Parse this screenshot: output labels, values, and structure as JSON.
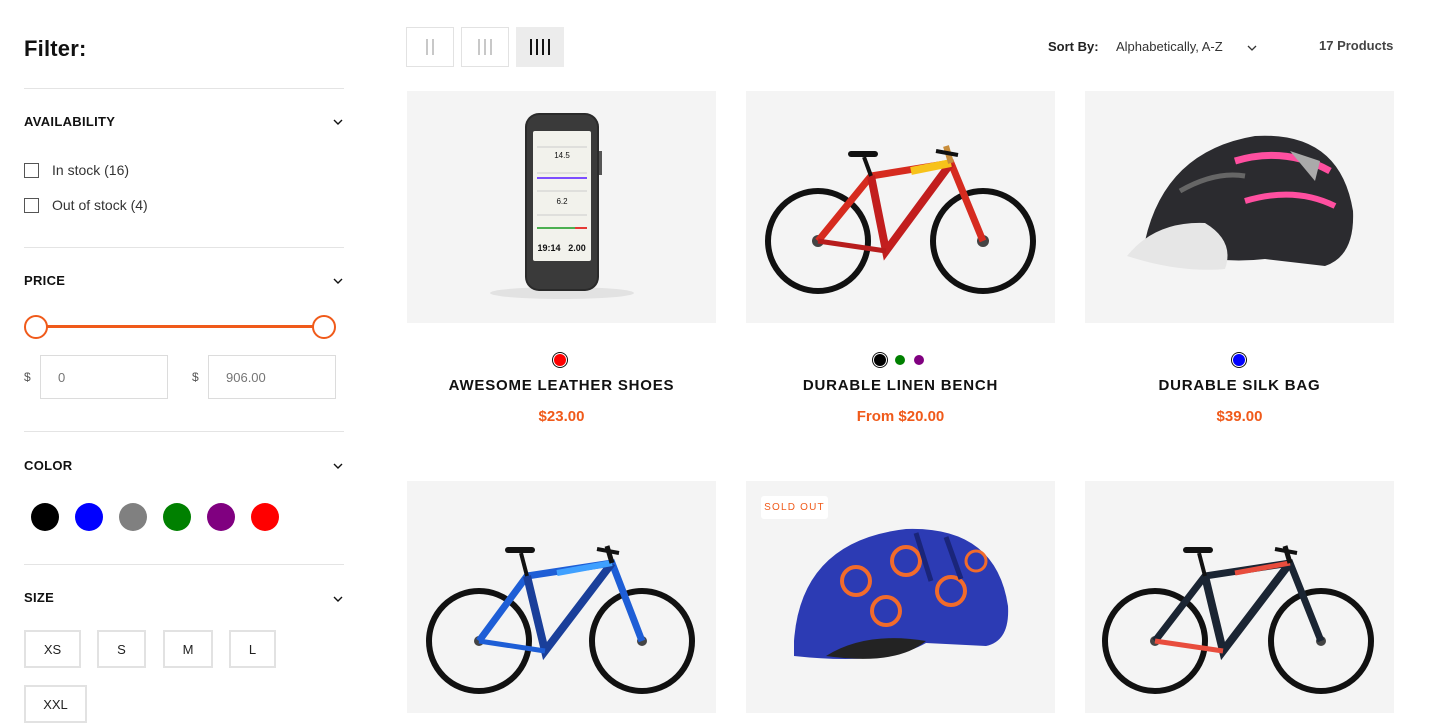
{
  "sidebar": {
    "title": "Filter:",
    "availability": {
      "title": "AVAILABILITY",
      "options": [
        {
          "label": "In stock (16)",
          "checked": false
        },
        {
          "label": "Out of stock (4)",
          "checked": false
        }
      ]
    },
    "price": {
      "title": "PRICE",
      "currency": "$",
      "min_value": "",
      "min_placeholder": "0",
      "max_value": "",
      "max_placeholder": "906.00"
    },
    "color": {
      "title": "COLOR",
      "swatches": [
        "#000000",
        "#0000ff",
        "#808080",
        "#008000",
        "#800080",
        "#ff0000"
      ]
    },
    "size": {
      "title": "SIZE",
      "options": [
        "XS",
        "S",
        "M",
        "L",
        "XXL"
      ]
    }
  },
  "toolbar": {
    "view_modes": [
      "2 columns",
      "3 columns",
      "4 columns"
    ],
    "active_view": "4 columns",
    "sort_label": "Sort By:",
    "sort_value": "Alphabetically, A-Z",
    "product_count": "17 Products"
  },
  "products": [
    {
      "name": "AWESOME LEATHER SHOES",
      "price": "$23.00",
      "colors": [
        "#ff0000"
      ],
      "image": "gps-computer"
    },
    {
      "name": "DURABLE LINEN BENCH",
      "price": "From $20.00",
      "colors": [
        "#000000",
        "#008000",
        "#800080"
      ],
      "image": "red-yellow-bike"
    },
    {
      "name": "DURABLE SILK BAG",
      "price": "$39.00",
      "colors": [
        "#0000ff"
      ],
      "image": "pink-helmet"
    },
    {
      "name": "",
      "price": "",
      "colors": [],
      "image": "blue-bike"
    },
    {
      "name": "",
      "price": "",
      "colors": [],
      "image": "blue-kids-helmet",
      "badge": "SOLD OUT"
    },
    {
      "name": "",
      "price": "",
      "colors": [],
      "image": "dark-red-bike"
    }
  ],
  "colors": {
    "accent": "#f05a1a"
  }
}
